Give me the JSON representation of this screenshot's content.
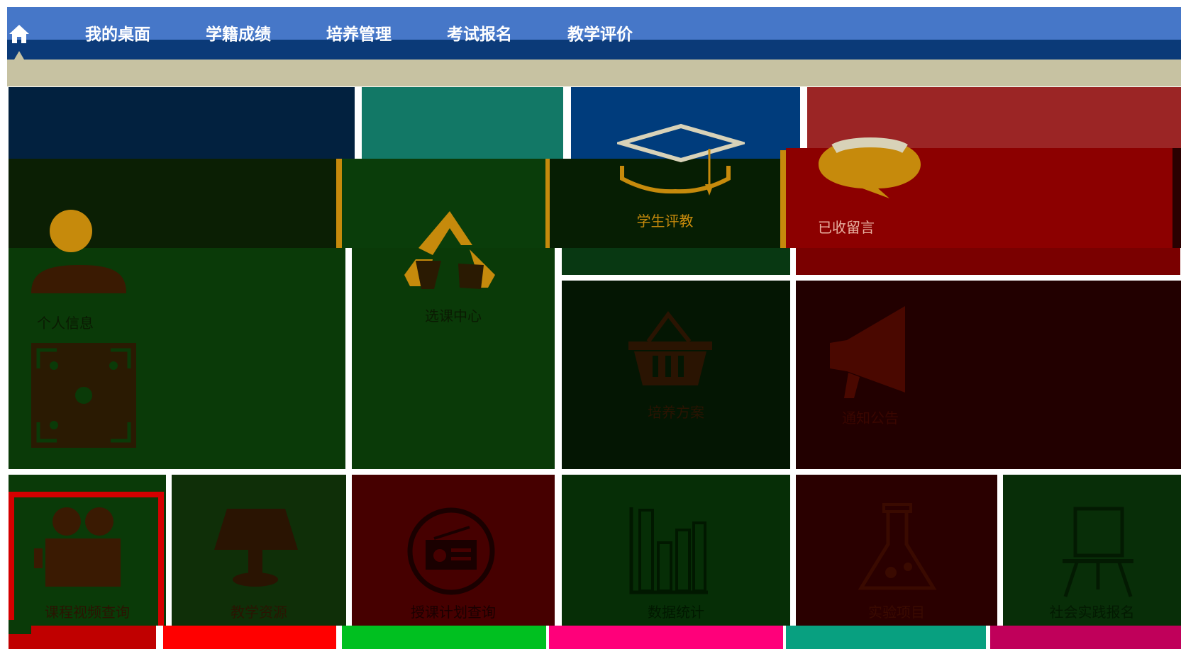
{
  "nav": {
    "home_icon": "home-icon",
    "items": [
      {
        "label": "我的桌面"
      },
      {
        "label": "学籍成绩"
      },
      {
        "label": "培养管理"
      },
      {
        "label": "考试报名"
      },
      {
        "label": "教学评价"
      }
    ]
  },
  "tiles": {
    "student_eval": {
      "label": "学生评教",
      "icon": "graduation-cap-icon"
    },
    "messages": {
      "label": "已收留言",
      "icon": "speech-bubble-icon"
    },
    "personal": {
      "label": "个人信息",
      "icon": "user-icon"
    },
    "qrcode": {
      "icon": "qr-scan-icon"
    },
    "recycle": {
      "label": "选课中心",
      "icon": "recycle-icon"
    },
    "basket": {
      "label": "培养方案",
      "icon": "basket-icon"
    },
    "announce": {
      "label": "通知公告",
      "icon": "megaphone-icon"
    },
    "row3": [
      {
        "label": "课程视频查询",
        "icon": "video-camera-icon"
      },
      {
        "label": "教学资源",
        "icon": "lamp-icon"
      },
      {
        "label": "授课计划查询",
        "icon": "radio-icon"
      },
      {
        "label": "数据统计",
        "icon": "bar-chart-icon"
      },
      {
        "label": "实验项目",
        "icon": "flask-icon"
      },
      {
        "label": "社会实践报名",
        "icon": "easel-icon"
      }
    ]
  },
  "colors": {
    "nav_blue": "#4677c8",
    "nav_dark": "#0b3a78",
    "accent_gold": "#c68a0c",
    "tile_red": "#8c0000"
  }
}
